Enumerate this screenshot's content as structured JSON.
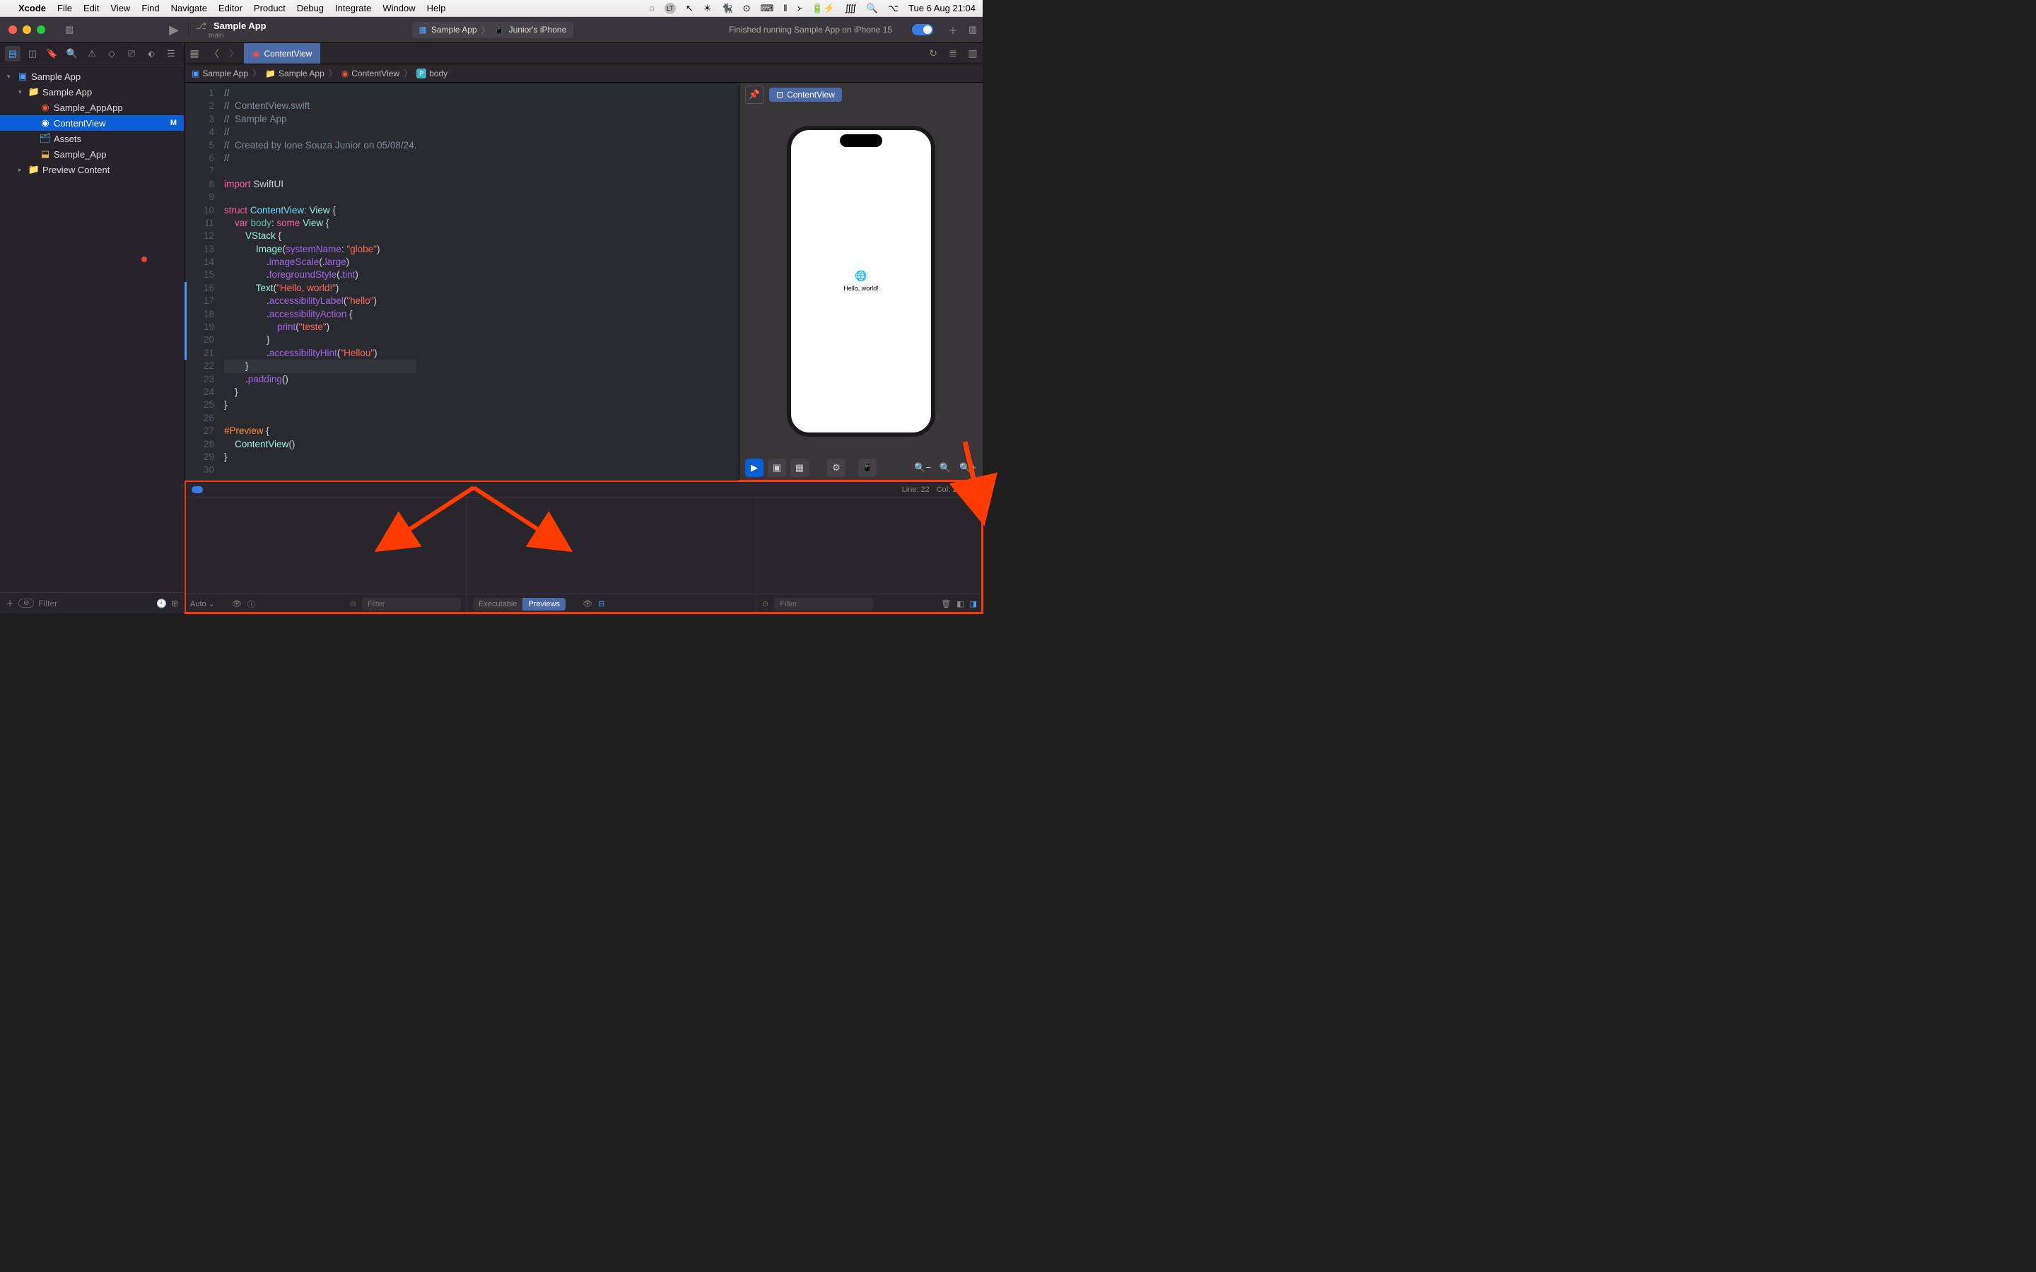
{
  "menubar": {
    "app": "Xcode",
    "items": [
      "File",
      "Edit",
      "View",
      "Find",
      "Navigate",
      "Editor",
      "Product",
      "Debug",
      "Integrate",
      "Window",
      "Help"
    ],
    "clock": "Tue 6 Aug  21:04"
  },
  "toolbar": {
    "project": "Sample App",
    "branch": "main",
    "scheme_app": "Sample App",
    "scheme_dest": "Junior's iPhone",
    "status": "Finished running Sample App on iPhone 15"
  },
  "navigator": {
    "root": "Sample App",
    "group": "Sample App",
    "files": [
      {
        "name": "Sample_AppApp",
        "icon": "swift"
      },
      {
        "name": "ContentView",
        "icon": "swift",
        "selected": true,
        "badge": "M"
      },
      {
        "name": "Assets",
        "icon": "assets"
      },
      {
        "name": "Sample_App",
        "icon": "assets"
      }
    ],
    "preview_group": "Preview Content",
    "filter_placeholder": "Filter"
  },
  "tabs": {
    "active": "ContentView"
  },
  "breadcrumb": [
    "Sample App",
    "Sample App",
    "ContentView",
    "body"
  ],
  "code": {
    "lines": [
      {
        "n": 1,
        "t": "//",
        "cls": "c-comment"
      },
      {
        "n": 2,
        "t": "//  ContentView.swift",
        "cls": "c-comment"
      },
      {
        "n": 3,
        "t": "//  Sample App",
        "cls": "c-comment"
      },
      {
        "n": 4,
        "t": "//",
        "cls": "c-comment"
      },
      {
        "n": 5,
        "t": "//  Created by Ione Souza Junior on 05/08/24.",
        "cls": "c-comment"
      },
      {
        "n": 6,
        "t": "//",
        "cls": "c-comment"
      },
      {
        "n": 7,
        "t": ""
      },
      {
        "n": 8,
        "html": "<span class='c-keyword'>import</span> <span class='c-plain'>SwiftUI</span>"
      },
      {
        "n": 9,
        "t": ""
      },
      {
        "n": 10,
        "html": "<span class='c-keyword'>struct</span> <span class='c-ident'>ContentView</span><span class='c-plain'>: </span><span class='c-type'>View</span><span class='c-plain'> {</span>"
      },
      {
        "n": 11,
        "html": "    <span class='c-keyword'>var</span> <span class='c-prop'>body</span><span class='c-plain'>: </span><span class='c-keyword'>some</span> <span class='c-type'>View</span><span class='c-plain'> {</span>"
      },
      {
        "n": 12,
        "html": "        <span class='c-type'>VStack</span><span class='c-plain'> {</span>"
      },
      {
        "n": 13,
        "html": "            <span class='c-type'>Image</span><span class='c-plain'>(</span><span class='c-func'>systemName</span><span class='c-plain'>: </span><span class='c-string'>\"globe\"</span><span class='c-plain'>)</span>"
      },
      {
        "n": 14,
        "html": "                <span class='c-plain'>.</span><span class='c-func'>imageScale</span><span class='c-plain'>(.</span><span class='c-enum'>large</span><span class='c-plain'>)</span>"
      },
      {
        "n": 15,
        "html": "                <span class='c-plain'>.</span><span class='c-func'>foregroundStyle</span><span class='c-plain'>(.</span><span class='c-enum'>tint</span><span class='c-plain'>)</span>"
      },
      {
        "n": 16,
        "html": "            <span class='c-type'>Text</span><span class='c-plain'>(</span><span class='c-string'>\"Hello, world!\"</span><span class='c-plain'>)</span>"
      },
      {
        "n": 17,
        "html": "                <span class='c-plain'>.</span><span class='c-func'>accessibilityLabel</span><span class='c-plain'>(</span><span class='c-string'>\"hello\"</span><span class='c-plain'>)</span>"
      },
      {
        "n": 18,
        "html": "                <span class='c-plain'>.</span><span class='c-func'>accessibilityAction</span><span class='c-plain'> {</span>"
      },
      {
        "n": 19,
        "html": "                    <span class='c-func'>print</span><span class='c-plain'>(</span><span class='c-string'>\"teste\"</span><span class='c-plain'>)</span>"
      },
      {
        "n": 20,
        "html": "                <span class='c-plain'>}</span>"
      },
      {
        "n": 21,
        "html": "                <span class='c-plain'>.</span><span class='c-func'>accessibilityHint</span><span class='c-plain'>(</span><span class='c-string'>\"Hellou\"</span><span class='c-plain'>)</span>"
      },
      {
        "n": 22,
        "html": "        <span class='c-plain'>}</span>",
        "hl": true
      },
      {
        "n": 23,
        "html": "        <span class='c-plain'>.</span><span class='c-func'>padding</span><span class='c-plain'>()</span>"
      },
      {
        "n": 24,
        "html": "    <span class='c-plain'>}</span>"
      },
      {
        "n": 25,
        "html": "<span class='c-plain'>}</span>"
      },
      {
        "n": 26,
        "t": ""
      },
      {
        "n": 27,
        "html": "<span class='c-macro'>#Preview</span><span class='c-plain'> {</span>"
      },
      {
        "n": 28,
        "html": "    <span class='c-type'>ContentView</span><span class='c-plain'>()</span>"
      },
      {
        "n": 29,
        "html": "<span class='c-plain'>}</span>"
      },
      {
        "n": 30,
        "t": ""
      }
    ]
  },
  "preview": {
    "tab": "ContentView",
    "text": "Hello, world!"
  },
  "status_bar": {
    "line": "Line: 22",
    "col": "Col: 10"
  },
  "debug": {
    "auto": "Auto",
    "filter_placeholder": "Filter",
    "seg_left": "Executable",
    "seg_right": "Previews"
  }
}
